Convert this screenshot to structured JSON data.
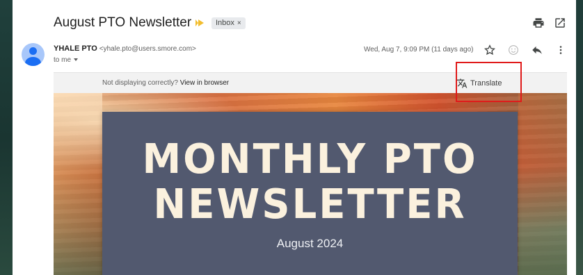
{
  "email": {
    "subject": "August PTO Newsletter",
    "label": "Inbox",
    "label_close": "×",
    "sender_name": "YHALE PTO",
    "sender_email": "<yhale.pto@users.smore.com>",
    "recipient": "to me",
    "datetime": "Wed, Aug 7, 9:09 PM (11 days ago)"
  },
  "notice": {
    "text": "Not displaying correctly?",
    "link": "View in browser",
    "translate_label": "Translate"
  },
  "newsletter": {
    "title_line1": "MONTHLY PTO",
    "title_line2": "NEWSLETTER",
    "date": "August 2024"
  },
  "icons": {
    "print": "print-icon",
    "open_new_window": "open-in-new-window-icon",
    "star": "star-icon",
    "emoji": "emoji-reaction-icon",
    "reply": "reply-icon",
    "more": "more-vert-icon",
    "translate": "translate-icon",
    "importance": "importance-marker-icon"
  },
  "colors": {
    "highlight_box": "#e01a1a",
    "title_card": "#52596f",
    "title_text": "#fbf1de",
    "importance": "#f2bd2e"
  }
}
